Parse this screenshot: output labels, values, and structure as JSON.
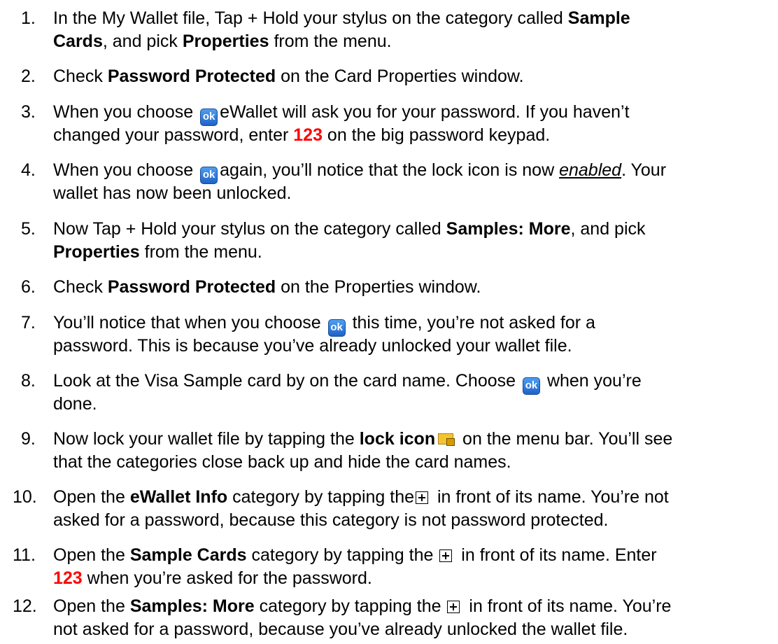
{
  "steps": [
    {
      "num": "1.",
      "l1": [
        "In the My Wallet file, Tap + Hold your stylus on the category called ",
        "Sample"
      ],
      "l2": [
        "Cards",
        ", and pick ",
        "Properties",
        " from the menu."
      ]
    },
    {
      "num": "2.",
      "l1": [
        "Check ",
        "Password Protected",
        " on the Card Properties window."
      ]
    },
    {
      "num": "3.",
      "l1": [
        "When you choose ",
        "eWallet will ask you for your password. If you haven’t"
      ],
      "l2": [
        "changed your password, enter ",
        "123",
        " on the big password keypad."
      ]
    },
    {
      "num": "4.",
      "l1": [
        "When you choose ",
        "again, you’ll notice that the lock icon is now ",
        "enabled",
        ". Your"
      ],
      "l2": [
        "wallet has now been unlocked."
      ]
    },
    {
      "num": "5.",
      "l1": [
        "Now Tap + Hold your stylus on the category called ",
        "Samples: More",
        ", and pick"
      ],
      "l2": [
        "Properties",
        " from the menu."
      ]
    },
    {
      "num": "6.",
      "l1": [
        "Check ",
        "Password Protected",
        " on the Properties window."
      ]
    },
    {
      "num": "7.",
      "l1": [
        "You’ll notice that when you choose ",
        " this time, you’re not asked for a"
      ],
      "l2": [
        "password. This is because you’ve already unlocked your wallet file."
      ]
    },
    {
      "num": "8.",
      "l1": [
        "Look at the Visa Sample card by on the card name. Choose ",
        " when you’re"
      ],
      "l2": [
        "done."
      ]
    },
    {
      "num": "9.",
      "l1": [
        "Now lock your wallet file by tapping the ",
        "lock icon",
        " on the menu bar. You’ll see"
      ],
      "l2": [
        "that the categories close back up and hide the card names."
      ]
    },
    {
      "num": "10.",
      "l1": [
        "Open the ",
        "eWallet Info",
        " category by tapping the",
        " in front of its name. You’re not"
      ],
      "l2": [
        "asked for a password, because this category is not password protected."
      ]
    },
    {
      "num": "11.",
      "l1": [
        "Open the ",
        "Sample Cards",
        " category by tapping the ",
        " in front of its name. Enter"
      ],
      "l2": [
        "123",
        " when you’re asked for the password."
      ]
    },
    {
      "num": "12.",
      "l1": [
        "Open the ",
        "Samples: More",
        " category by tapping the ",
        " in front of its name. You’re"
      ],
      "l2": [
        "not asked for a password, because you’ve already unlocked the wallet file."
      ]
    }
  ],
  "icons": {
    "ok_label": "ok",
    "ok_color": "#2a74d8",
    "lock": "lock-icon",
    "expand": "expand-plus-box-icon"
  },
  "colors": {
    "highlight": "#ff0000",
    "text": "#000000",
    "background": "#ffffff"
  }
}
